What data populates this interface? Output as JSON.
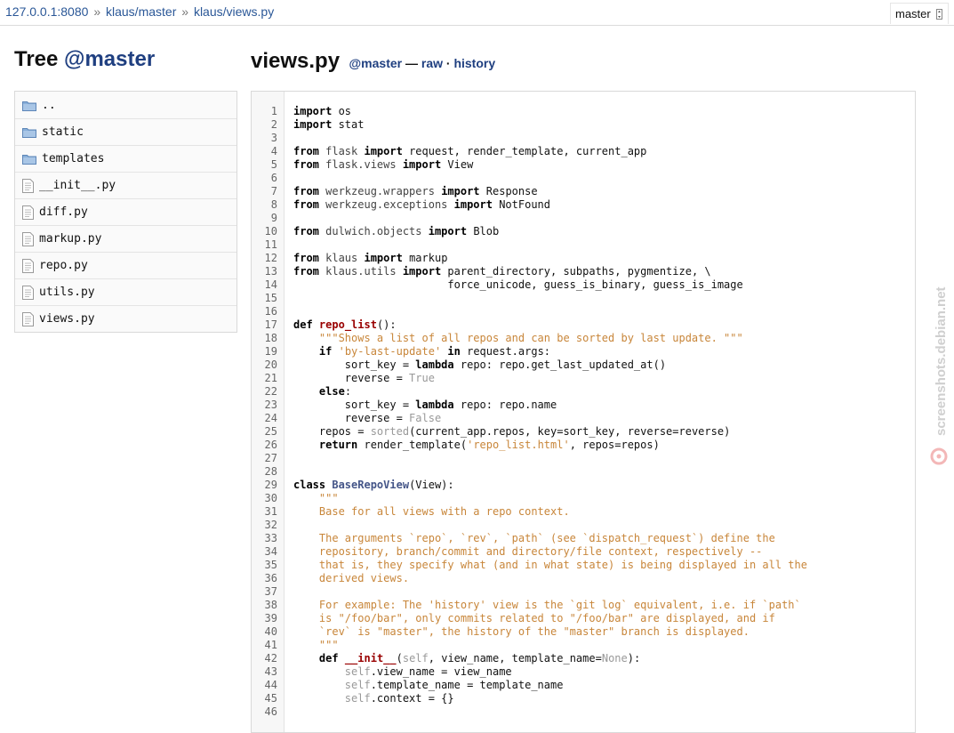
{
  "breadcrumb": {
    "items": [
      "127.0.0.1:8080",
      "klaus/master",
      "klaus/views.py"
    ],
    "separator": "»"
  },
  "branch_selector": {
    "value": "master",
    "icon": "branch-dropdown-icon"
  },
  "tree_heading": {
    "prefix": "Tree ",
    "branch": "@master"
  },
  "files": [
    {
      "name": "..",
      "type": "folder"
    },
    {
      "name": "static",
      "type": "folder"
    },
    {
      "name": "templates",
      "type": "folder"
    },
    {
      "name": "__init__.py",
      "type": "file"
    },
    {
      "name": "diff.py",
      "type": "file"
    },
    {
      "name": "markup.py",
      "type": "file"
    },
    {
      "name": "repo.py",
      "type": "file"
    },
    {
      "name": "utils.py",
      "type": "file"
    },
    {
      "name": "views.py",
      "type": "file"
    }
  ],
  "file_header": {
    "filename": "views.py",
    "branch": "@master",
    "dash": "—",
    "raw_link": "raw",
    "dot": "·",
    "history_link": "history"
  },
  "code": {
    "lines": [
      [
        [
          "k",
          "import"
        ],
        [
          "n",
          " os"
        ]
      ],
      [
        [
          "k",
          "import"
        ],
        [
          "n",
          " stat"
        ]
      ],
      [],
      [
        [
          "k",
          "from"
        ],
        [
          "nm",
          " flask "
        ],
        [
          "k",
          "import"
        ],
        [
          "n",
          " request, render_template, current_app"
        ]
      ],
      [
        [
          "k",
          "from"
        ],
        [
          "nm",
          " flask.views "
        ],
        [
          "k",
          "import"
        ],
        [
          "n",
          " View"
        ]
      ],
      [],
      [
        [
          "k",
          "from"
        ],
        [
          "nm",
          " werkzeug.wrappers "
        ],
        [
          "k",
          "import"
        ],
        [
          "n",
          " Response"
        ]
      ],
      [
        [
          "k",
          "from"
        ],
        [
          "nm",
          " werkzeug.exceptions "
        ],
        [
          "k",
          "import"
        ],
        [
          "n",
          " NotFound"
        ]
      ],
      [],
      [
        [
          "k",
          "from"
        ],
        [
          "nm",
          " dulwich.objects "
        ],
        [
          "k",
          "import"
        ],
        [
          "n",
          " Blob"
        ]
      ],
      [],
      [
        [
          "k",
          "from"
        ],
        [
          "nm",
          " klaus "
        ],
        [
          "k",
          "import"
        ],
        [
          "n",
          " markup"
        ]
      ],
      [
        [
          "k",
          "from"
        ],
        [
          "nm",
          " klaus.utils "
        ],
        [
          "k",
          "import"
        ],
        [
          "n",
          " parent_directory, subpaths, pygmentize, \\"
        ]
      ],
      [
        [
          "n",
          "                        force_unicode, guess_is_binary, guess_is_image"
        ]
      ],
      [],
      [],
      [
        [
          "k",
          "def"
        ],
        [
          "n",
          " "
        ],
        [
          "fn",
          "repo_list"
        ],
        [
          "n",
          "():"
        ]
      ],
      [
        [
          "n",
          "    "
        ],
        [
          "doc",
          "\"\"\"Shows a list of all repos and can be sorted by last update. \"\"\""
        ]
      ],
      [
        [
          "n",
          "    "
        ],
        [
          "k",
          "if"
        ],
        [
          "n",
          " "
        ],
        [
          "s",
          "'by-last-update'"
        ],
        [
          "n",
          " "
        ],
        [
          "k",
          "in"
        ],
        [
          "n",
          " request.args:"
        ]
      ],
      [
        [
          "n",
          "        sort_key = "
        ],
        [
          "k",
          "lambda"
        ],
        [
          "n",
          " repo: repo.get_last_updated_at()"
        ]
      ],
      [
        [
          "n",
          "        reverse = "
        ],
        [
          "bi",
          "True"
        ]
      ],
      [
        [
          "n",
          "    "
        ],
        [
          "k",
          "else"
        ],
        [
          "n",
          ":"
        ]
      ],
      [
        [
          "n",
          "        sort_key = "
        ],
        [
          "k",
          "lambda"
        ],
        [
          "n",
          " repo: repo.name"
        ]
      ],
      [
        [
          "n",
          "        reverse = "
        ],
        [
          "bi",
          "False"
        ]
      ],
      [
        [
          "n",
          "    repos = "
        ],
        [
          "bi",
          "sorted"
        ],
        [
          "n",
          "(current_app.repos, key=sort_key, reverse=reverse)"
        ]
      ],
      [
        [
          "n",
          "    "
        ],
        [
          "k",
          "return"
        ],
        [
          "n",
          " render_template("
        ],
        [
          "s",
          "'repo_list.html'"
        ],
        [
          "n",
          ", repos=repos)"
        ]
      ],
      [],
      [],
      [
        [
          "k",
          "class"
        ],
        [
          "n",
          " "
        ],
        [
          "cls",
          "BaseRepoView"
        ],
        [
          "n",
          "(View):"
        ]
      ],
      [
        [
          "n",
          "    "
        ],
        [
          "doc",
          "\"\"\""
        ]
      ],
      [
        [
          "n",
          "    "
        ],
        [
          "doc",
          "Base for all views with a repo context."
        ]
      ],
      [],
      [
        [
          "n",
          "    "
        ],
        [
          "doc",
          "The arguments `repo`, `rev`, `path` (see `dispatch_request`) define the"
        ]
      ],
      [
        [
          "n",
          "    "
        ],
        [
          "doc",
          "repository, branch/commit and directory/file context, respectively --"
        ]
      ],
      [
        [
          "n",
          "    "
        ],
        [
          "doc",
          "that is, they specify what (and in what state) is being displayed in all the"
        ]
      ],
      [
        [
          "n",
          "    "
        ],
        [
          "doc",
          "derived views."
        ]
      ],
      [],
      [
        [
          "n",
          "    "
        ],
        [
          "doc",
          "For example: The 'history' view is the `git log` equivalent, i.e. if `path`"
        ]
      ],
      [
        [
          "n",
          "    "
        ],
        [
          "doc",
          "is \"/foo/bar\", only commits related to \"/foo/bar\" are displayed, and if"
        ]
      ],
      [
        [
          "n",
          "    "
        ],
        [
          "doc",
          "`rev` is \"master\", the history of the \"master\" branch is displayed."
        ]
      ],
      [
        [
          "n",
          "    "
        ],
        [
          "doc",
          "\"\"\""
        ]
      ],
      [
        [
          "n",
          "    "
        ],
        [
          "k",
          "def"
        ],
        [
          "n",
          " "
        ],
        [
          "fn",
          "__init__"
        ],
        [
          "n",
          "("
        ],
        [
          "se",
          "self"
        ],
        [
          "n",
          ", view_name, template_name="
        ],
        [
          "bi",
          "None"
        ],
        [
          "n",
          "):"
        ]
      ],
      [
        [
          "n",
          "        "
        ],
        [
          "se",
          "self"
        ],
        [
          "n",
          ".view_name = view_name"
        ]
      ],
      [
        [
          "n",
          "        "
        ],
        [
          "se",
          "self"
        ],
        [
          "n",
          ".template_name = template_name"
        ]
      ],
      [
        [
          "n",
          "        "
        ],
        [
          "se",
          "self"
        ],
        [
          "n",
          ".context = {}"
        ]
      ],
      []
    ]
  },
  "watermark": "screenshots.debian.net"
}
